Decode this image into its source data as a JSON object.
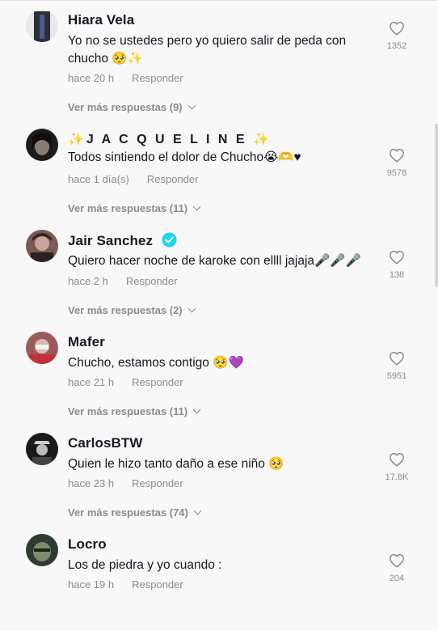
{
  "comments": [
    {
      "name": "Hiara Vela",
      "text": "Yo no se ustedes pero yo quiero salir de peda con chucho 🥺✨",
      "time": "hace 20 h",
      "reply": "Responder",
      "more": "Ver más respuestas (9)",
      "likes": "1352"
    },
    {
      "name": "✨J A C Q U E L I N E ✨",
      "text": "Todos sintiendo el dolor de Chucho😭🫶♥",
      "time": "hace 1 día(s)",
      "reply": "Responder",
      "more": "Ver más respuestas (11)",
      "likes": "9578"
    },
    {
      "name": "Jair Sanchez",
      "text": "Quiero hacer noche de karoke con ellll jajaja🎤🎤🎤",
      "time": "hace 2 h",
      "reply": "Responder",
      "more": "Ver más respuestas (2)",
      "likes": "138"
    },
    {
      "name": "Mafer",
      "text": "Chucho, estamos contigo 🥺💜",
      "time": "hace 21 h",
      "reply": "Responder",
      "more": "Ver más respuestas (11)",
      "likes": "5951"
    },
    {
      "name": "CarlosBTW",
      "text": "Quien le hizo tanto daño a ese niño 🥺",
      "time": "hace 23 h",
      "reply": "Responder",
      "more": "Ver más respuestas (74)",
      "likes": "17.8K"
    },
    {
      "name": "Locro",
      "text": "Los de piedra y yo cuando :",
      "time": "hace 19 h",
      "reply": "Responder",
      "more": "",
      "likes": "204"
    }
  ],
  "colors": {
    "verified": "#20d5ec",
    "text": "#161823",
    "muted": "#8a8b91"
  }
}
